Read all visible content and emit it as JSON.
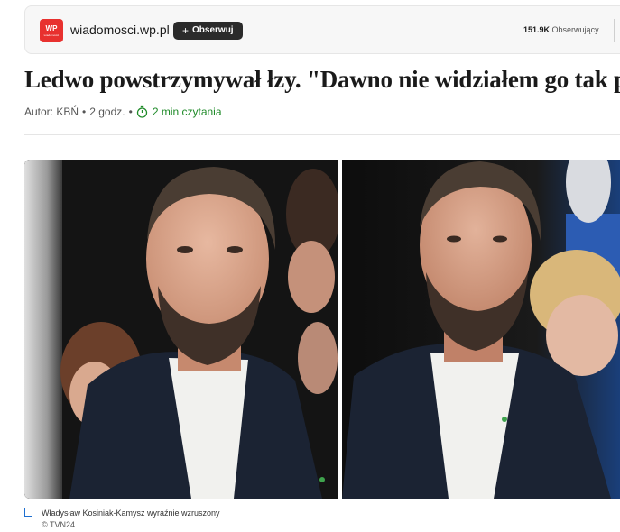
{
  "publisher": {
    "logo_text": "WP",
    "logo_subtext": "wiadomości",
    "name": "wiadomosci.wp.pl",
    "follow_label": "Obserwuj",
    "followers_count": "151.9K",
    "followers_label": "Obserwujący"
  },
  "article": {
    "headline": "Ledwo powstrzymywał łzy. \"Dawno nie widziałem go tak przybitego\"",
    "author": "Autor: KBŃ",
    "time_ago": "2 godz.",
    "separator": "•",
    "reading_time": "2 min czytania"
  },
  "image": {
    "alt": "Władysław Kosiniak-Kamysz wyraźnie wzruszony",
    "caption": "Władysław Kosiniak-Kamysz wyraźnie wzruszony",
    "credit": "© TVN24"
  },
  "colors": {
    "brand_red": "#e8312f",
    "reading_green": "#1e8a28",
    "caption_accent": "#1e6fd0",
    "follow_button": "#2b2b2b"
  },
  "icons": {
    "publisher_logo": "wp-logo-icon",
    "follow": "plus-icon",
    "reading_time": "stopwatch-icon"
  }
}
